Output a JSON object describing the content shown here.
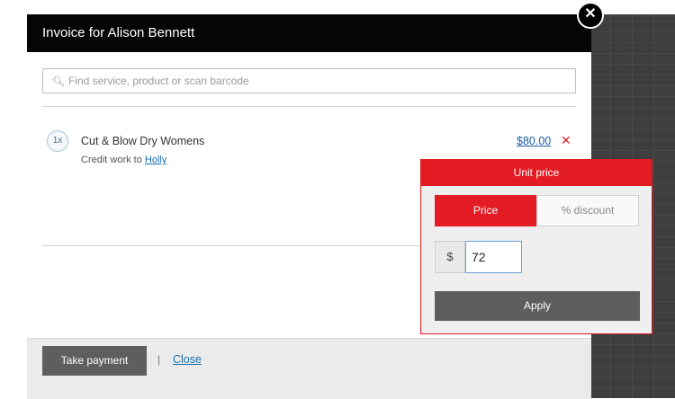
{
  "modal": {
    "title": "Invoice for Alison Bennett",
    "close_icon": "close-icon"
  },
  "search": {
    "icon": "search-icon",
    "placeholder": "Find service, product or scan barcode",
    "value": ""
  },
  "line_item": {
    "quantity": "1x",
    "name": "Cut & Blow Dry Womens",
    "credit_prefix": "Credit work to",
    "credit_staff": "Holly",
    "price": "$80.00",
    "remove_symbol": "✕"
  },
  "footer": {
    "take_payment_label": "Take payment",
    "separator": "|",
    "close_label": "Close"
  },
  "unit_price_popover": {
    "title": "Unit price",
    "tabs": [
      {
        "label": "Price",
        "active": true
      },
      {
        "label": "% discount",
        "active": false
      }
    ],
    "currency_symbol": "$",
    "price_value": "72",
    "apply_label": "Apply"
  },
  "colors": {
    "accent_red": "#e31b23",
    "header_black": "#050505",
    "link_blue": "#1a6fb3",
    "button_gray": "#5e5e5e"
  }
}
